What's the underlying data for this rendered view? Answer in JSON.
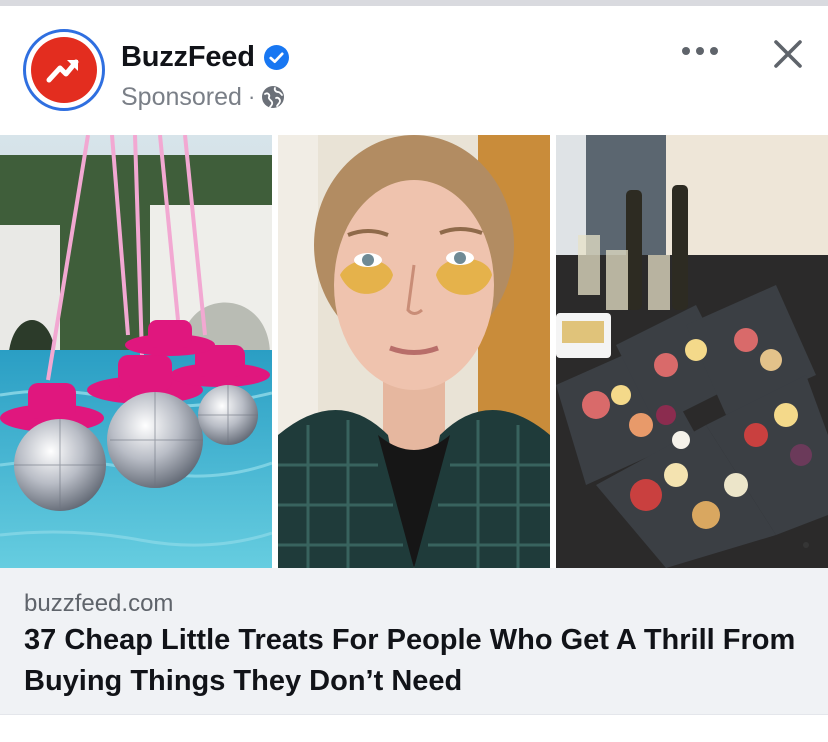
{
  "post": {
    "page_name": "BuzzFeed",
    "sponsored_label": "Sponsored",
    "separator": "·",
    "avatar_icon": "buzzfeed-trending-arrow-icon",
    "verified_icon": "verified-badge-icon",
    "audience_icon": "globe-icon",
    "more_icon": "more-options-icon",
    "close_icon": "close-icon"
  },
  "images": [
    {
      "icon": "photo-pink-cowboy-hat-disco-balls"
    },
    {
      "icon": "photo-woman-gold-eye-patches"
    },
    {
      "icon": "photo-charcuterie-boards"
    }
  ],
  "link": {
    "domain": "buzzfeed.com",
    "headline": "37 Cheap Little Treats For People Who Get A Thrill From Buying Things They Don’t Need"
  },
  "colors": {
    "brand_red": "#e32d1f",
    "avatar_ring": "#2f6fe0",
    "verified_blue": "#1877f2",
    "text_primary": "#111318",
    "text_secondary": "#7a7f87",
    "card_bg": "#f0f2f5"
  }
}
